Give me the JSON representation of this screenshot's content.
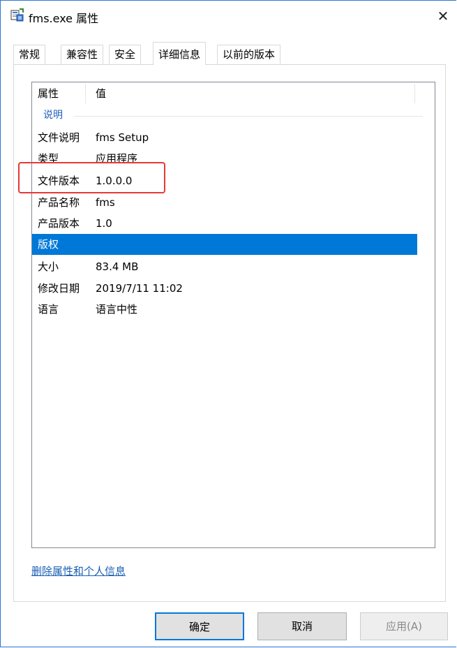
{
  "window": {
    "title": "fms.exe 属性",
    "close_glyph": "✕"
  },
  "tabs": [
    {
      "label": "常规",
      "active": false
    },
    {
      "label": "兼容性",
      "active": false
    },
    {
      "label": "安全",
      "active": false
    },
    {
      "label": "详细信息",
      "active": true
    },
    {
      "label": "以前的版本",
      "active": false
    }
  ],
  "details": {
    "columns": [
      "属性",
      "值"
    ],
    "group": "说明",
    "rows": [
      {
        "key": "文件说明",
        "value": "fms Setup"
      },
      {
        "key": "类型",
        "value": "应用程序"
      },
      {
        "key": "文件版本",
        "value": "1.0.0.0"
      },
      {
        "key": "产品名称",
        "value": "fms"
      },
      {
        "key": "产品版本",
        "value": "1.0"
      },
      {
        "key": "版权",
        "value": ""
      },
      {
        "key": "大小",
        "value": "83.4 MB"
      },
      {
        "key": "修改日期",
        "value": "2019/7/11 11:02"
      },
      {
        "key": "语言",
        "value": "语言中性"
      }
    ],
    "selected_row": "版权",
    "highlighted_row": "文件版本"
  },
  "remove_link": "删除属性和个人信息",
  "buttons": {
    "ok": "确定",
    "cancel": "取消",
    "apply": "应用(A)"
  },
  "colors": {
    "accent": "#0078d7",
    "highlight_border": "#e53935",
    "link": "#1a5fb4"
  },
  "icons": [
    "app-setup-icon",
    "close-icon"
  ]
}
